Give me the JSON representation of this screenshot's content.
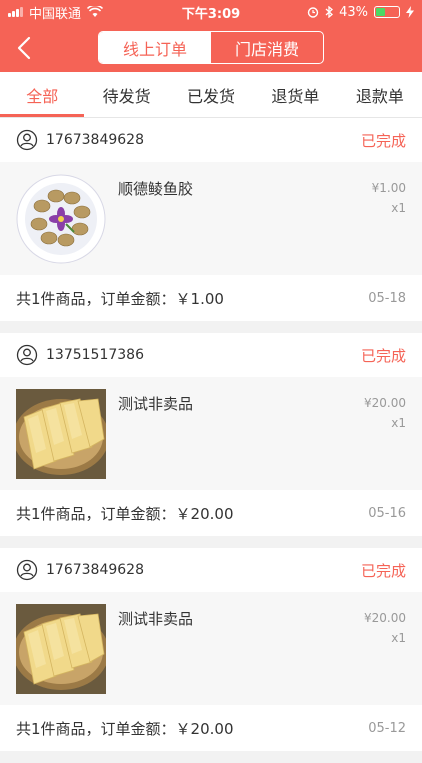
{
  "status_bar": {
    "carrier": "中国联通",
    "time": "下午3:09",
    "battery": "43%"
  },
  "header": {
    "segments": [
      "线上订单",
      "门店消费"
    ],
    "active_segment": 0
  },
  "tabs": [
    "全部",
    "待发货",
    "已发货",
    "退货单",
    "退款单"
  ],
  "orders": [
    {
      "phone": "17673849628",
      "status": "已完成",
      "product": "顺德鲮鱼胶",
      "price": "¥1.00",
      "qty": "x1",
      "summary": "共1件商品，订单金额：￥1.00",
      "date": "05-18"
    },
    {
      "phone": "13751517386",
      "status": "已完成",
      "product": "测试非卖品",
      "price": "¥20.00",
      "qty": "x1",
      "summary": "共1件商品，订单金额：￥20.00",
      "date": "05-16"
    },
    {
      "phone": "17673849628",
      "status": "已完成",
      "product": "测试非卖品",
      "price": "¥20.00",
      "qty": "x1",
      "summary": "共1件商品，订单金额：￥20.00",
      "date": "05-12"
    }
  ]
}
